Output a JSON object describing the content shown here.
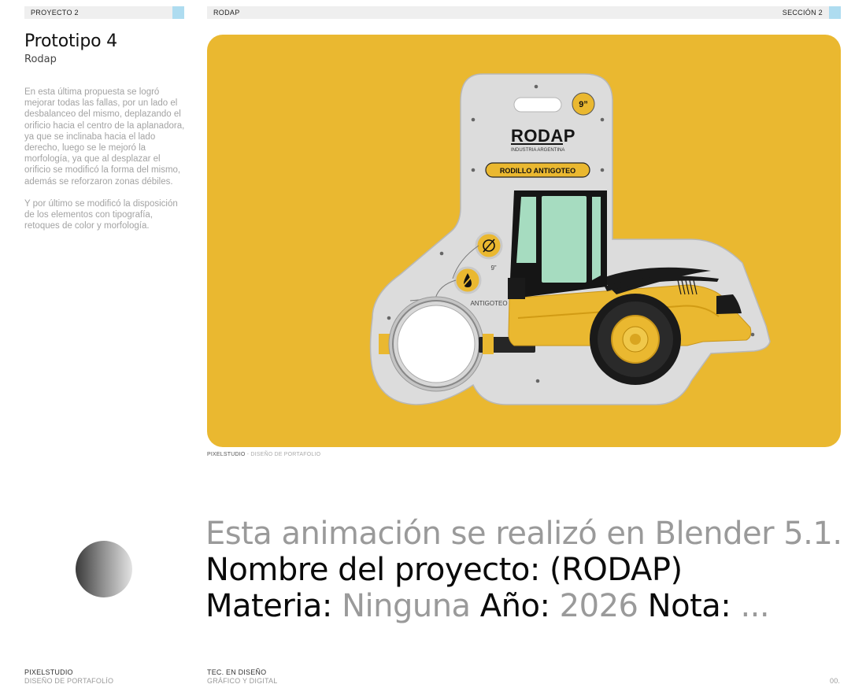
{
  "header": {
    "left_label": "PROYECTO 2",
    "center_label": "RODAP",
    "right_label": "SECCIÓN 2"
  },
  "title": "Prototipo 4",
  "subtitle": "Rodap",
  "description": [
    "En esta última propuesta se logró mejorar todas las fallas, por un lado el desbalanceo del mismo, deplazando el orificio hacia el centro de la aplanadora, ya que se inclinaba hacia el lado derecho, luego se le mejoró la morfología, ya que al desplazar el orificio se modificó la forma del mismo, además se reforzaron zonas débiles.",
    "Y por último se modificó la disposición de los elementos con tipografía, retoques de color y morfología."
  ],
  "product": {
    "size_badge": "9”",
    "brand": "RODAP",
    "brand_sub": "INDUSTRIA ARGENTINA",
    "label": "RODILLO ANTIGOTEO",
    "size_icon_label": "9”",
    "drip_icon_label": "ANTIGOTEO"
  },
  "caption": {
    "brand": "PIXELSTUDIO",
    "text": " - DISEÑO DE PORTAFOLIO"
  },
  "statement": {
    "line1": "Esta animación se realizó en Blender 5.1.",
    "line2": "Nombre del proyecto: (RODAP)",
    "materia_label": "Materia: ",
    "materia_value": "Ninguna",
    "anio_label": " Año: ",
    "anio_value": "2026",
    "nota_label": " Nota: ",
    "nota_value": "..."
  },
  "footer": {
    "col1_title": "PIXELSTUDIO",
    "col1_sub": "DISEÑO DE PORTAFOLÍO",
    "col2_title": "TEC. EN DISEÑO",
    "col2_sub": "GRÁFICO Y DIGITAL",
    "page": "00."
  },
  "colors": {
    "stage_bg": "#eab830",
    "accent": "#aedcf0",
    "card": "#dcdcdc",
    "cab_glass": "#a6dcc0"
  }
}
